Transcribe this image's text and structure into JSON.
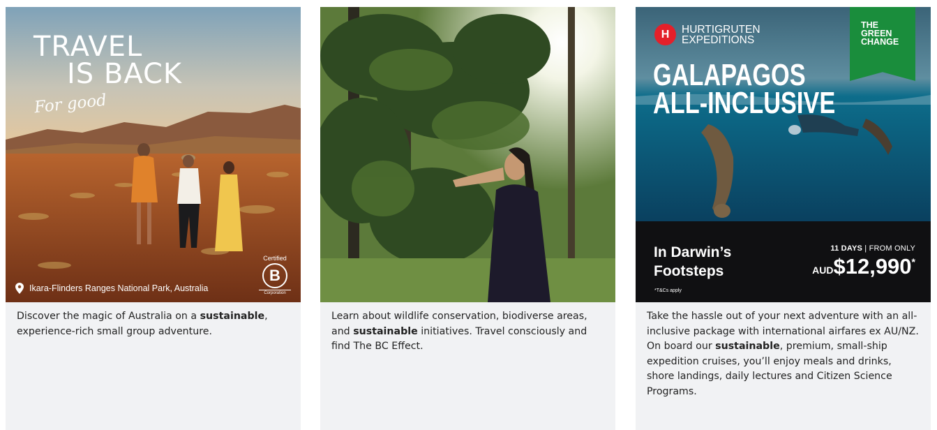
{
  "cards": [
    {
      "image": {
        "title_line1": "TRAVEL",
        "title_line2": "IS BACK",
        "script": "For good",
        "location": "Ikara-Flinders Ranges National Park, Australia",
        "badge_top": "Certified",
        "badge_letter": "B",
        "badge_bottom": "Corporation"
      },
      "caption": {
        "before": "Discover the magic of Australia on a ",
        "bold": "sustainable",
        "after": ", experience-rich small group adventure."
      }
    },
    {
      "image": {},
      "caption": {
        "before": "Learn about wildlife conservation, biodiverse areas, and ",
        "bold": "sustainable",
        "after": " initiatives. Travel consciously and find The BC Effect."
      }
    },
    {
      "image": {
        "brand_line1": "HURTIGRUTEN",
        "brand_line2": "EXPEDITIONS",
        "logo_letter": "H",
        "green_line1": "THE",
        "green_line2": "GREEN",
        "green_line3": "CHANGE",
        "headline1": "GALAPAGOS",
        "headline2": "ALL-INCLUSIVE",
        "footer_title": "In Darwin’s Footsteps",
        "terms": "*T&Cs apply",
        "days": "11 DAYS",
        "from": "FROM ONLY",
        "currency": "AUD",
        "price": "$12,990",
        "asterisk": "*"
      },
      "caption": {
        "before": "Take the hassle out of your next adventure with an all-inclusive package with international airfares ex AU/NZ. On board our ",
        "bold": "sustainable",
        "after": ", premium, small-ship expedition cruises, you’ll enjoy meals and drinks, shore landings, daily lectures and Citizen Science Programs."
      }
    }
  ],
  "colors": {
    "card_bg": "#f1f2f4",
    "brand_red": "#e4202a",
    "green_badge": "#1a8d3c",
    "band_dark": "#101012"
  }
}
